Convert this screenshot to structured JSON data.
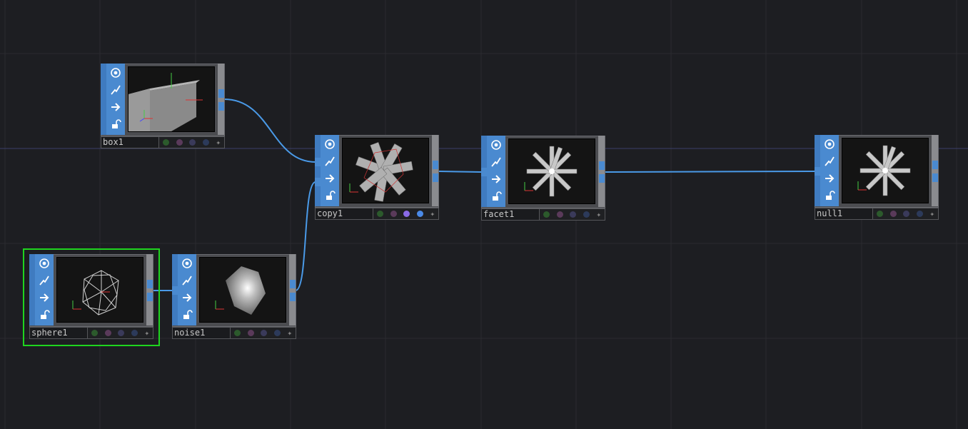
{
  "network": {
    "nodes": [
      {
        "id": "box1",
        "name": "box1",
        "selected": false
      },
      {
        "id": "copy1",
        "name": "copy1",
        "selected": false
      },
      {
        "id": "facet1",
        "name": "facet1",
        "selected": false
      },
      {
        "id": "null1",
        "name": "null1",
        "selected": false
      },
      {
        "id": "sphere1",
        "name": "sphere1",
        "selected": true
      },
      {
        "id": "noise1",
        "name": "noise1",
        "selected": false
      }
    ],
    "connections": [
      {
        "from": "box1",
        "to": "copy1"
      },
      {
        "from": "noise1",
        "to": "copy1"
      },
      {
        "from": "sphere1",
        "to": "noise1"
      },
      {
        "from": "copy1",
        "to": "facet1"
      },
      {
        "from": "facet1",
        "to": "null1"
      }
    ],
    "toolbar_icons": [
      "viewer-active-icon",
      "bypass-icon",
      "display-flag-icon",
      "lock-icon"
    ],
    "flag_colors": {
      "green": "#2c5a2c",
      "purple": "#5a3a5a",
      "slate": "#3a3a5a",
      "navy": "#2c3a5a",
      "violet_on": "#8a6be8",
      "blue_on": "#4a8ae8"
    },
    "colors": {
      "background": "#1d1e22",
      "wire": "#4a9ae8",
      "selection": "#1fd41f",
      "node_blue": "#4a8ad0"
    }
  }
}
